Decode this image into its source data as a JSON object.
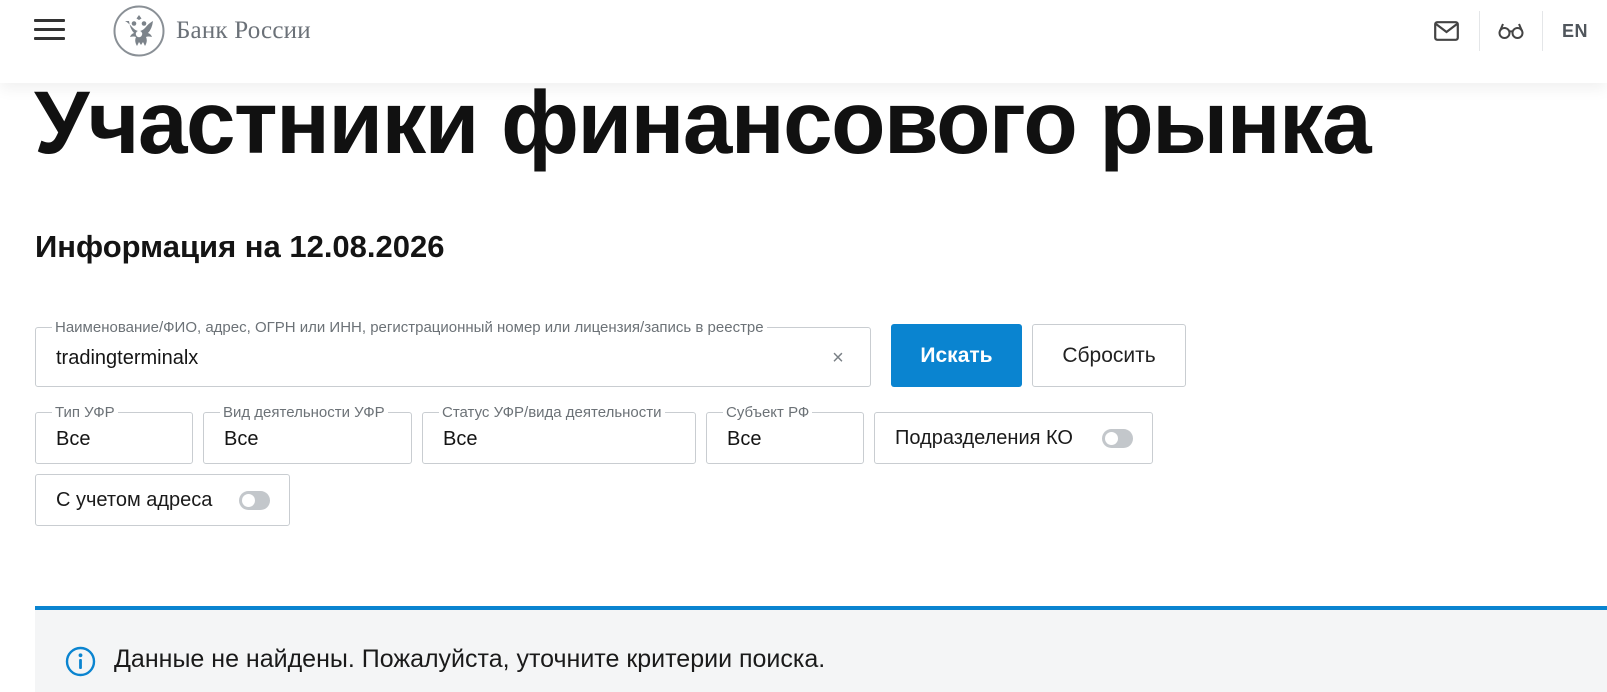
{
  "header": {
    "logo_text": "Банк России",
    "lang_label": "EN",
    "icons": [
      "menu-icon",
      "bank-emblem-icon",
      "mail-icon",
      "glasses-icon"
    ]
  },
  "page": {
    "title": "Участники финансового рынка",
    "info_date": "Информация на 12.08.2026"
  },
  "search": {
    "label": "Наименование/ФИО, адрес, ОГРН или ИНН, регистрационный номер или лицензия/запись в реестре",
    "value": "tradingterminalx",
    "clear_symbol": "×",
    "search_button": "Искать",
    "reset_button": "Сбросить"
  },
  "filters": {
    "type": {
      "label": "Тип УФР",
      "value": "Все"
    },
    "activity": {
      "label": "Вид деятельности УФР",
      "value": "Все"
    },
    "status": {
      "label": "Статус УФР/вида деятельности",
      "value": "Все"
    },
    "subject": {
      "label": "Субъект РФ",
      "value": "Все"
    },
    "divisions_ko": {
      "label": "Подразделения КО",
      "enabled": false
    },
    "with_address": {
      "label": "С учетом адреса",
      "enabled": false
    }
  },
  "notice": {
    "text": "Данные не найдены. Пожалуйста, уточните критерии поиска."
  },
  "colors": {
    "accent": "#0a84d0",
    "notice_bg": "#f4f5f6",
    "border": "#c9cdd1",
    "muted_text": "#6c7277"
  }
}
